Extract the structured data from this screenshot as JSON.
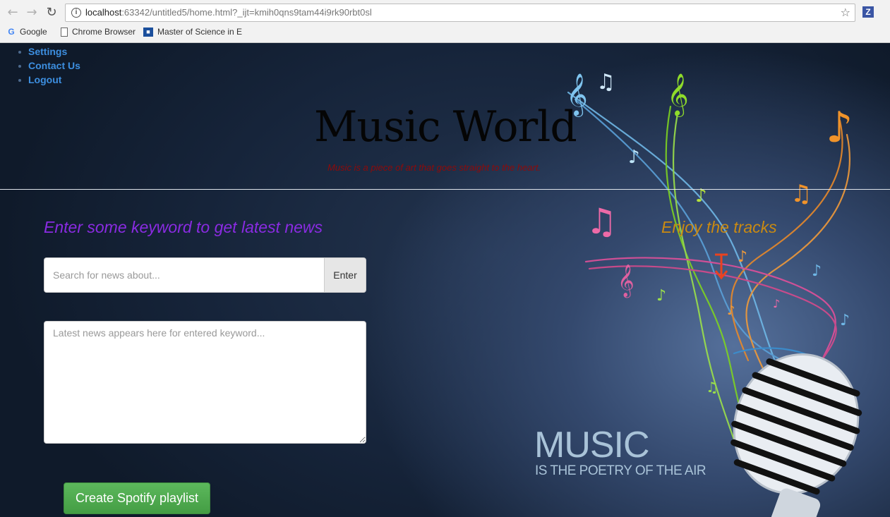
{
  "browser": {
    "url_host": "localhost",
    "url_rest": ":63342/untitled5/home.html?_ijt=kmih0qns9tam44i9rk90rbt0sl",
    "extension_label": "Z",
    "bookmarks": [
      {
        "label": "Google",
        "icon": "google-icon"
      },
      {
        "label": "Chrome Browser",
        "icon": "page-icon"
      },
      {
        "label": "Master of Science in E",
        "icon": "university-icon"
      }
    ]
  },
  "nav": {
    "items": [
      "Settings",
      "Contact Us",
      "Logout"
    ]
  },
  "header": {
    "title": "Music World",
    "tagline": "Music is a piece of art that goes straight to the heart."
  },
  "news": {
    "heading": "Enter some keyword to get latest news",
    "search_placeholder": "Search for news about...",
    "enter_label": "Enter",
    "output_placeholder": "Latest news appears here for entered keyword..."
  },
  "spotify": {
    "button_label": "Create Spotify playlist"
  },
  "tracks": {
    "heading": "Enjoy the tracks",
    "arrow_icon": "arrow-down-icon"
  },
  "hero": {
    "word": "MUSIC",
    "subtitle": "IS THE POETRY OF THE AIR"
  },
  "colors": {
    "nav_link": "#3d8fe0",
    "tagline": "#8e0a0a",
    "news_heading": "#8a2be2",
    "tracks_heading": "#c98a12",
    "spotify_button": "#5cb85c"
  }
}
